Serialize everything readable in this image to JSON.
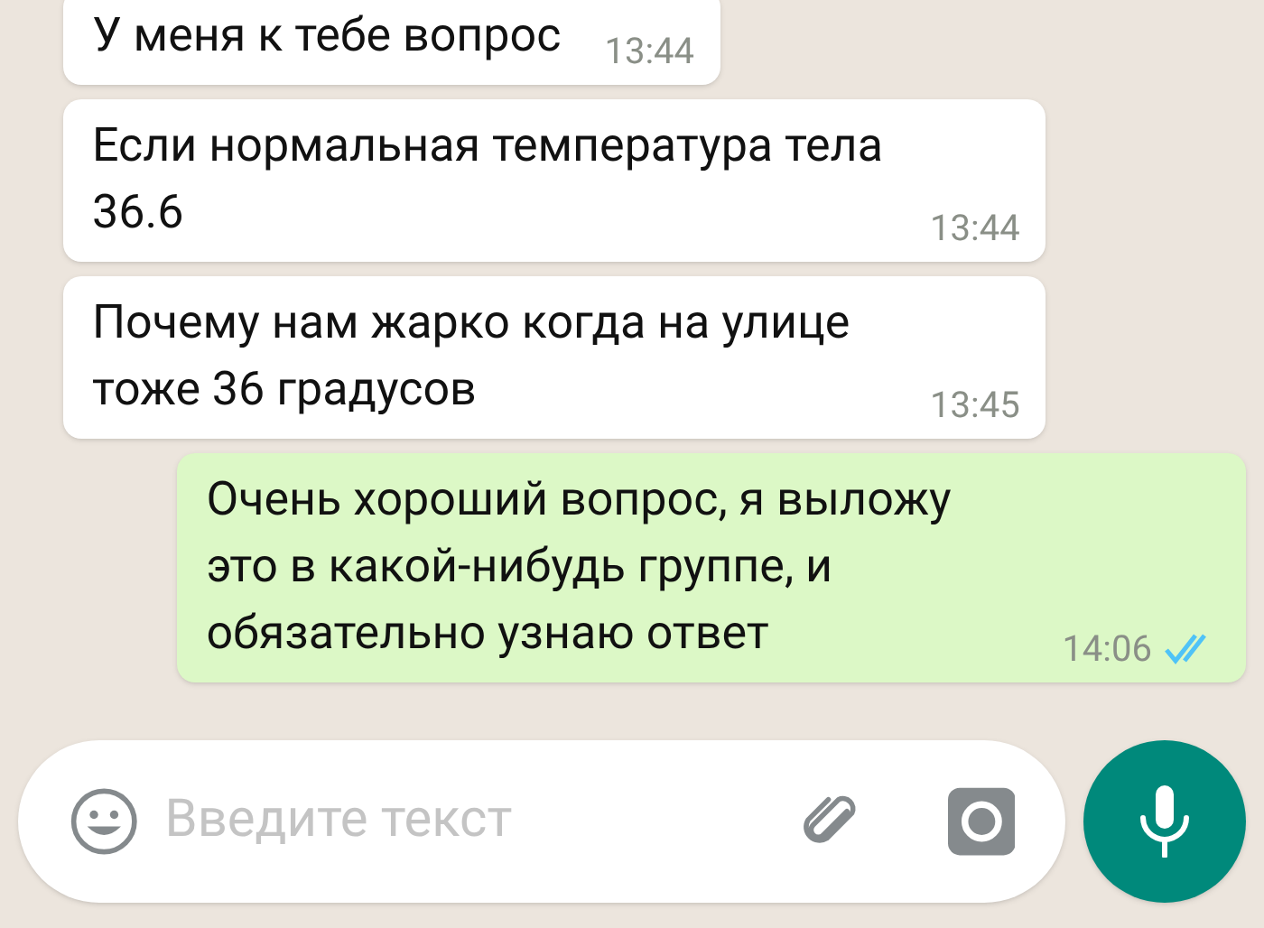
{
  "messages": [
    {
      "kind": "incoming",
      "text": "У меня к тебе вопрос",
      "time": "13:44"
    },
    {
      "kind": "incoming",
      "text": "Если нормальная температура тела 36.6",
      "time": "13:44"
    },
    {
      "kind": "incoming",
      "text": "Почему нам жарко когда на улице тоже 36 градусов",
      "time": "13:45"
    },
    {
      "kind": "outgoing",
      "text": "Очень хороший вопрос, я выложу это в какой-нибудь группе, и обязательно узнаю ответ",
      "time": "14:06",
      "read": true
    }
  ],
  "composer": {
    "placeholder": "Введите текст"
  }
}
